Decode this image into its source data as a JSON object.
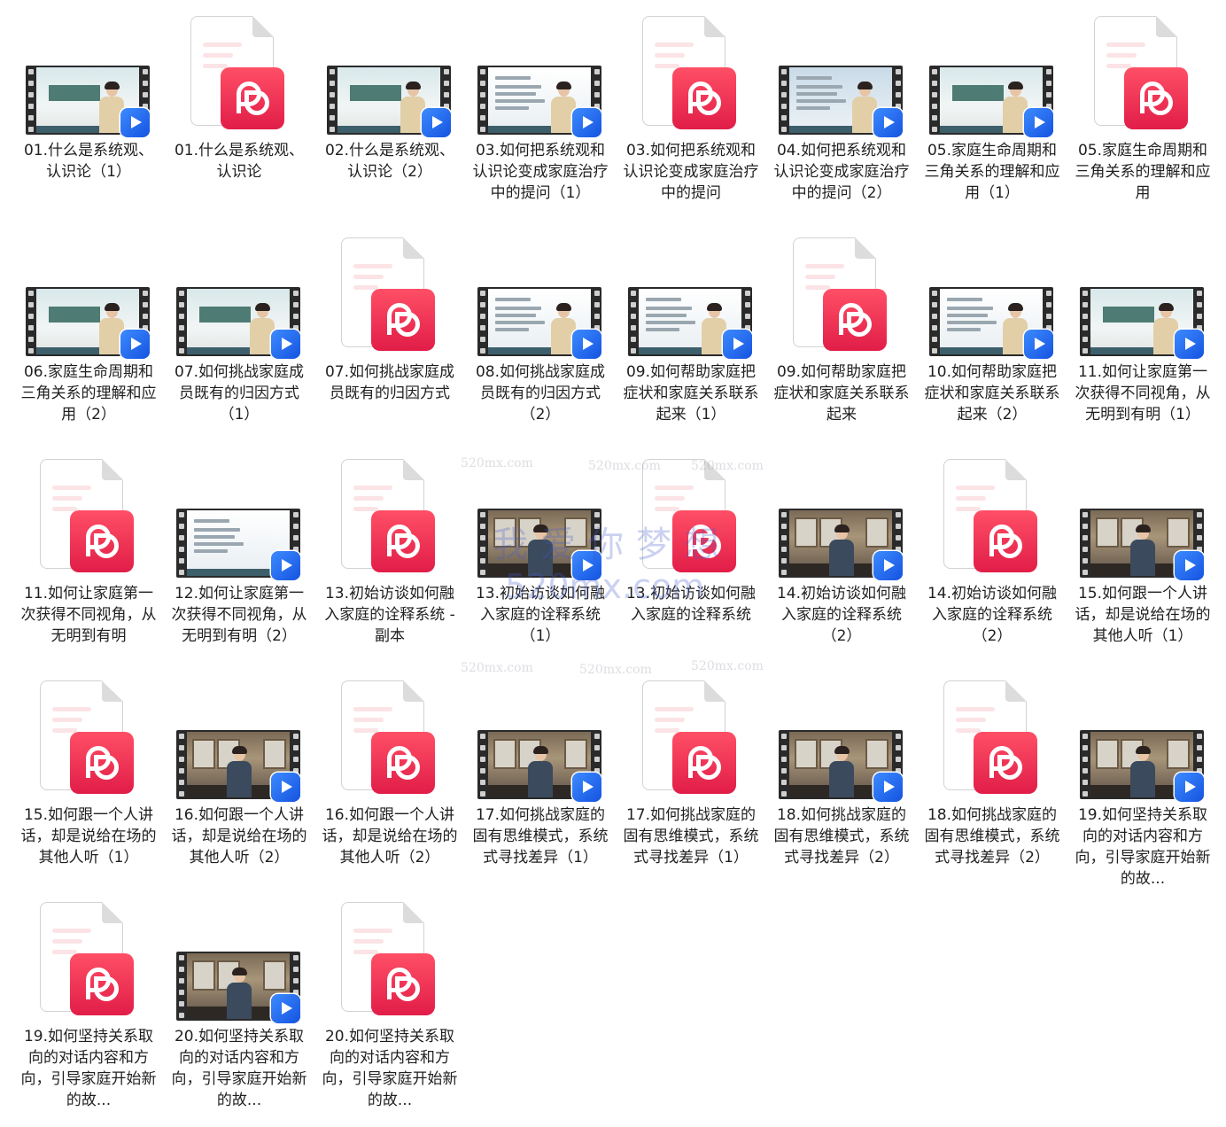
{
  "files": [
    {
      "label": "01.什么是系统观、认识论（1）",
      "kind": "video",
      "scene": "slide-green",
      "person": "beige"
    },
    {
      "label": "01.什么是系统观、认识论",
      "kind": "doc"
    },
    {
      "label": "02.什么是系统观、认识论（2）",
      "kind": "video",
      "scene": "slide-green",
      "person": "beige"
    },
    {
      "label": "03.如何把系统观和认识论变成家庭治疗中的提问（1）",
      "kind": "video",
      "scene": "slide",
      "person": "beige"
    },
    {
      "label": "03.如何把系统观和认识论变成家庭治疗中的提问",
      "kind": "doc"
    },
    {
      "label": "04.如何把系统观和认识论变成家庭治疗中的提问（2）",
      "kind": "video",
      "scene": "slide-blue",
      "person": "beige"
    },
    {
      "label": "05.家庭生命周期和三角关系的理解和应用（1）",
      "kind": "video",
      "scene": "slide-green",
      "person": "beige"
    },
    {
      "label": "05.家庭生命周期和三角关系的理解和应用",
      "kind": "doc"
    },
    {
      "label": "06.家庭生命周期和三角关系的理解和应用（2）",
      "kind": "video",
      "scene": "slide-green",
      "person": "beige"
    },
    {
      "label": "07.如何挑战家庭成员既有的归因方式（1）",
      "kind": "video",
      "scene": "slide-green",
      "person": "beige"
    },
    {
      "label": "07.如何挑战家庭成员既有的归因方式",
      "kind": "doc"
    },
    {
      "label": "08.如何挑战家庭成员既有的归因方式（2）",
      "kind": "video",
      "scene": "slide",
      "person": "beige"
    },
    {
      "label": "09.如何帮助家庭把症状和家庭关系联系起来（1）",
      "kind": "video",
      "scene": "slide",
      "person": "beige"
    },
    {
      "label": "09.如何帮助家庭把症状和家庭关系联系起来",
      "kind": "doc"
    },
    {
      "label": "10.如何帮助家庭把症状和家庭关系联系起来（2）",
      "kind": "video",
      "scene": "slide",
      "person": "beige"
    },
    {
      "label": "11.如何让家庭第一次获得不同视角，从无明到有明（1）",
      "kind": "video",
      "scene": "slide-green",
      "person": "beige"
    },
    {
      "label": "11.如何让家庭第一次获得不同视角，从无明到有明",
      "kind": "doc"
    },
    {
      "label": "12.如何让家庭第一次获得不同视角，从无明到有明（2）",
      "kind": "video",
      "scene": "slide",
      "person": "none"
    },
    {
      "label": "13.初始访谈如何融入家庭的诠释系统 - 副本",
      "kind": "doc"
    },
    {
      "label": "13.初始访谈如何融入家庭的诠释系统（1）",
      "kind": "video",
      "scene": "room",
      "person": "dark"
    },
    {
      "label": "13.初始访谈如何融入家庭的诠释系统",
      "kind": "doc"
    },
    {
      "label": "14.初始访谈如何融入家庭的诠释系统（2）",
      "kind": "video",
      "scene": "room",
      "person": "dark"
    },
    {
      "label": "14.初始访谈如何融入家庭的诠释系统（2）",
      "kind": "doc"
    },
    {
      "label": "15.如何跟一个人讲话，却是说给在场的其他人听（1）",
      "kind": "video",
      "scene": "room",
      "person": "dark"
    },
    {
      "label": "15.如何跟一个人讲话，却是说给在场的其他人听（1）",
      "kind": "doc"
    },
    {
      "label": "16.如何跟一个人讲话，却是说给在场的其他人听（2）",
      "kind": "video",
      "scene": "room",
      "person": "dark"
    },
    {
      "label": "16.如何跟一个人讲话，却是说给在场的其他人听（2）",
      "kind": "doc"
    },
    {
      "label": "17.如何挑战家庭的固有思维模式，系统式寻找差异（1）",
      "kind": "video",
      "scene": "room",
      "person": "dark"
    },
    {
      "label": "17.如何挑战家庭的固有思维模式，系统式寻找差异（1）",
      "kind": "doc"
    },
    {
      "label": "18.如何挑战家庭的固有思维模式，系统式寻找差异（2）",
      "kind": "video",
      "scene": "room",
      "person": "dark"
    },
    {
      "label": "18.如何挑战家庭的固有思维模式，系统式寻找差异（2）",
      "kind": "doc"
    },
    {
      "label": "19.如何坚持关系取向的对话内容和方向，引导家庭开始新的故...",
      "kind": "video",
      "scene": "room",
      "person": "dark"
    },
    {
      "label": "19.如何坚持关系取向的对话内容和方向，引导家庭开始新的故...",
      "kind": "doc"
    },
    {
      "label": "20.如何坚持关系取向的对话内容和方向，引导家庭开始新的故...",
      "kind": "video",
      "scene": "room",
      "person": "dark"
    },
    {
      "label": "20.如何坚持关系取向的对话内容和方向，引导家庭开始新的故...",
      "kind": "doc"
    }
  ],
  "watermark": {
    "slogan": "我爱你梦想",
    "url": "520mx.com",
    "small": "520mx.com"
  }
}
